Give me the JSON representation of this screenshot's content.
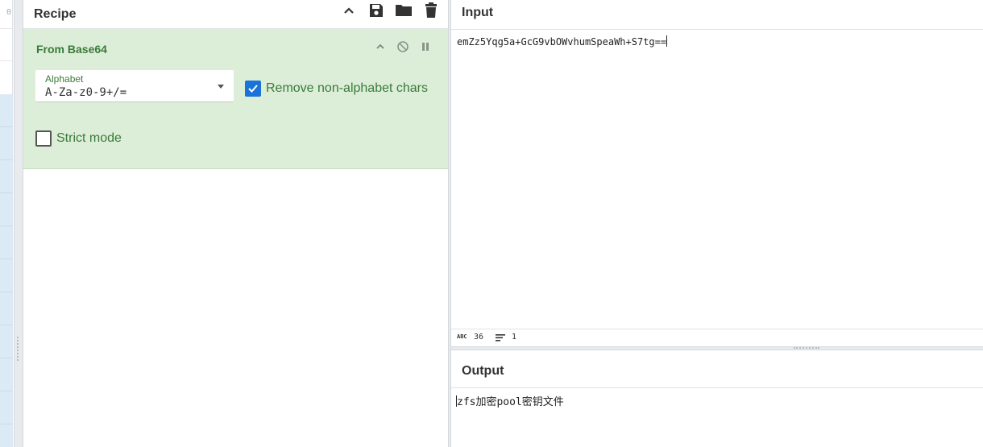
{
  "ops_strip": {
    "top_fragment": "0"
  },
  "recipe": {
    "title": "Recipe",
    "icons": [
      "chevron-up-icon",
      "save-icon",
      "folder-icon",
      "trash-icon"
    ]
  },
  "operation": {
    "title": "From Base64",
    "alphabet_label": "Alphabet",
    "alphabet_value": "A-Za-z0-9+/=",
    "remove_non_alphabet_label": "Remove non-alphabet chars",
    "remove_non_alphabet_checked": true,
    "strict_mode_label": "Strict mode",
    "strict_mode_checked": false
  },
  "input": {
    "title": "Input",
    "text": "emZz5Yqg5a+GcG9vbOWvhumSpeaWh+S7tg==",
    "status_length": "36",
    "status_lines": "1",
    "abc_label": "ABC"
  },
  "output": {
    "title": "Output",
    "text": "zfs加密pool密钥文件"
  },
  "colors": {
    "op_bg": "#dcedd8",
    "op_text": "#3a7b3a",
    "checkbox_accent": "#1a73d9",
    "ops_item_bg": "#dceaf5"
  }
}
